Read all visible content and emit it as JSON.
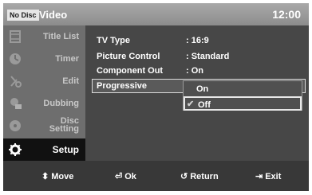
{
  "header": {
    "disc_status": "No Disc",
    "title": "Video",
    "clock": "12:00"
  },
  "sidebar": {
    "items": [
      {
        "label": "Title List",
        "icon": "film-icon"
      },
      {
        "label": "Timer",
        "icon": "timer-icon"
      },
      {
        "label": "Edit",
        "icon": "scissors-icon"
      },
      {
        "label": "Dubbing",
        "icon": "dubbing-icon"
      },
      {
        "label1": "Disc",
        "label2": "Setting",
        "icon": "disc-icon"
      },
      {
        "label": "Setup",
        "icon": "gear-icon",
        "active": true
      }
    ]
  },
  "settings": [
    {
      "name": "TV Type",
      "value": ": 16:9"
    },
    {
      "name": "Picture Control",
      "value": ": Standard"
    },
    {
      "name": "Component Out",
      "value": ": On"
    },
    {
      "name": "Progressive",
      "value": ""
    }
  ],
  "dropdown": {
    "options": [
      "On",
      "Off"
    ],
    "selected": "Off"
  },
  "footer": {
    "move": "Move",
    "ok": "Ok",
    "return": "Return",
    "exit": "Exit"
  },
  "colors": {
    "content_bg": "#474747",
    "sidebar_bg": "#6e6e6e",
    "footer_bg": "#383838"
  }
}
